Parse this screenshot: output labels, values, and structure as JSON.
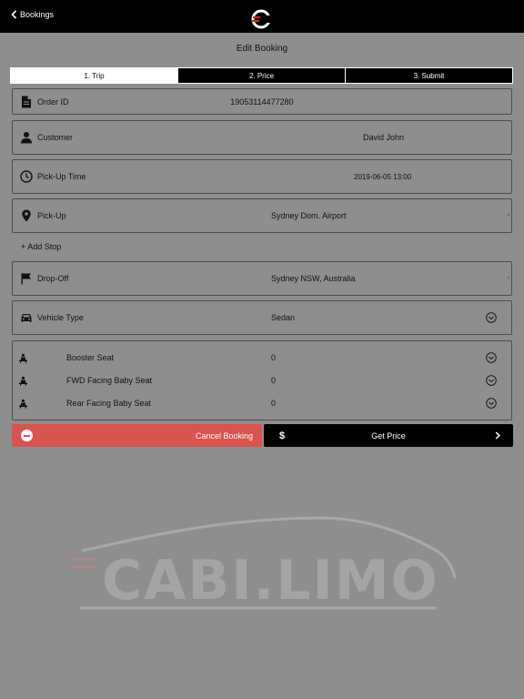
{
  "topbar": {
    "back_label": "Bookings"
  },
  "page": {
    "title": "Edit Booking"
  },
  "tabs": [
    {
      "label": "1. Trip",
      "active": true
    },
    {
      "label": "2. Price",
      "active": false
    },
    {
      "label": "3. Submit",
      "active": false
    }
  ],
  "fields": {
    "order_id": {
      "label": "Order ID",
      "value": "19053114477280"
    },
    "customer": {
      "label": "Customer",
      "value": "David John"
    },
    "pickup_time": {
      "label": "Pick-Up Time",
      "value": "2019-06-05 13:00"
    },
    "pickup": {
      "label": "Pick-Up",
      "value": "Sydney Dom. Airport"
    },
    "add_stop": "+ Add Stop",
    "dropoff": {
      "label": "Drop-Off",
      "value": "Sydney NSW, Australia"
    },
    "vehicle": {
      "label": "Vehicle Type",
      "value": "Sedan"
    }
  },
  "seats": [
    {
      "label": "Booster Seat",
      "value": "0"
    },
    {
      "label": "FWD Facing Baby Seat",
      "value": "0"
    },
    {
      "label": "Rear Facing Baby Seat",
      "value": "0"
    }
  ],
  "actions": {
    "cancel_label": "Cancel Booking",
    "price_label": "Get Price",
    "price_symbol": "$"
  },
  "watermark": {
    "text": "CABI.LIMO"
  },
  "colors": {
    "topbar": "#000000",
    "background": "#8e8e8e",
    "cancel": "#d9534f",
    "accent": "#e02020"
  }
}
